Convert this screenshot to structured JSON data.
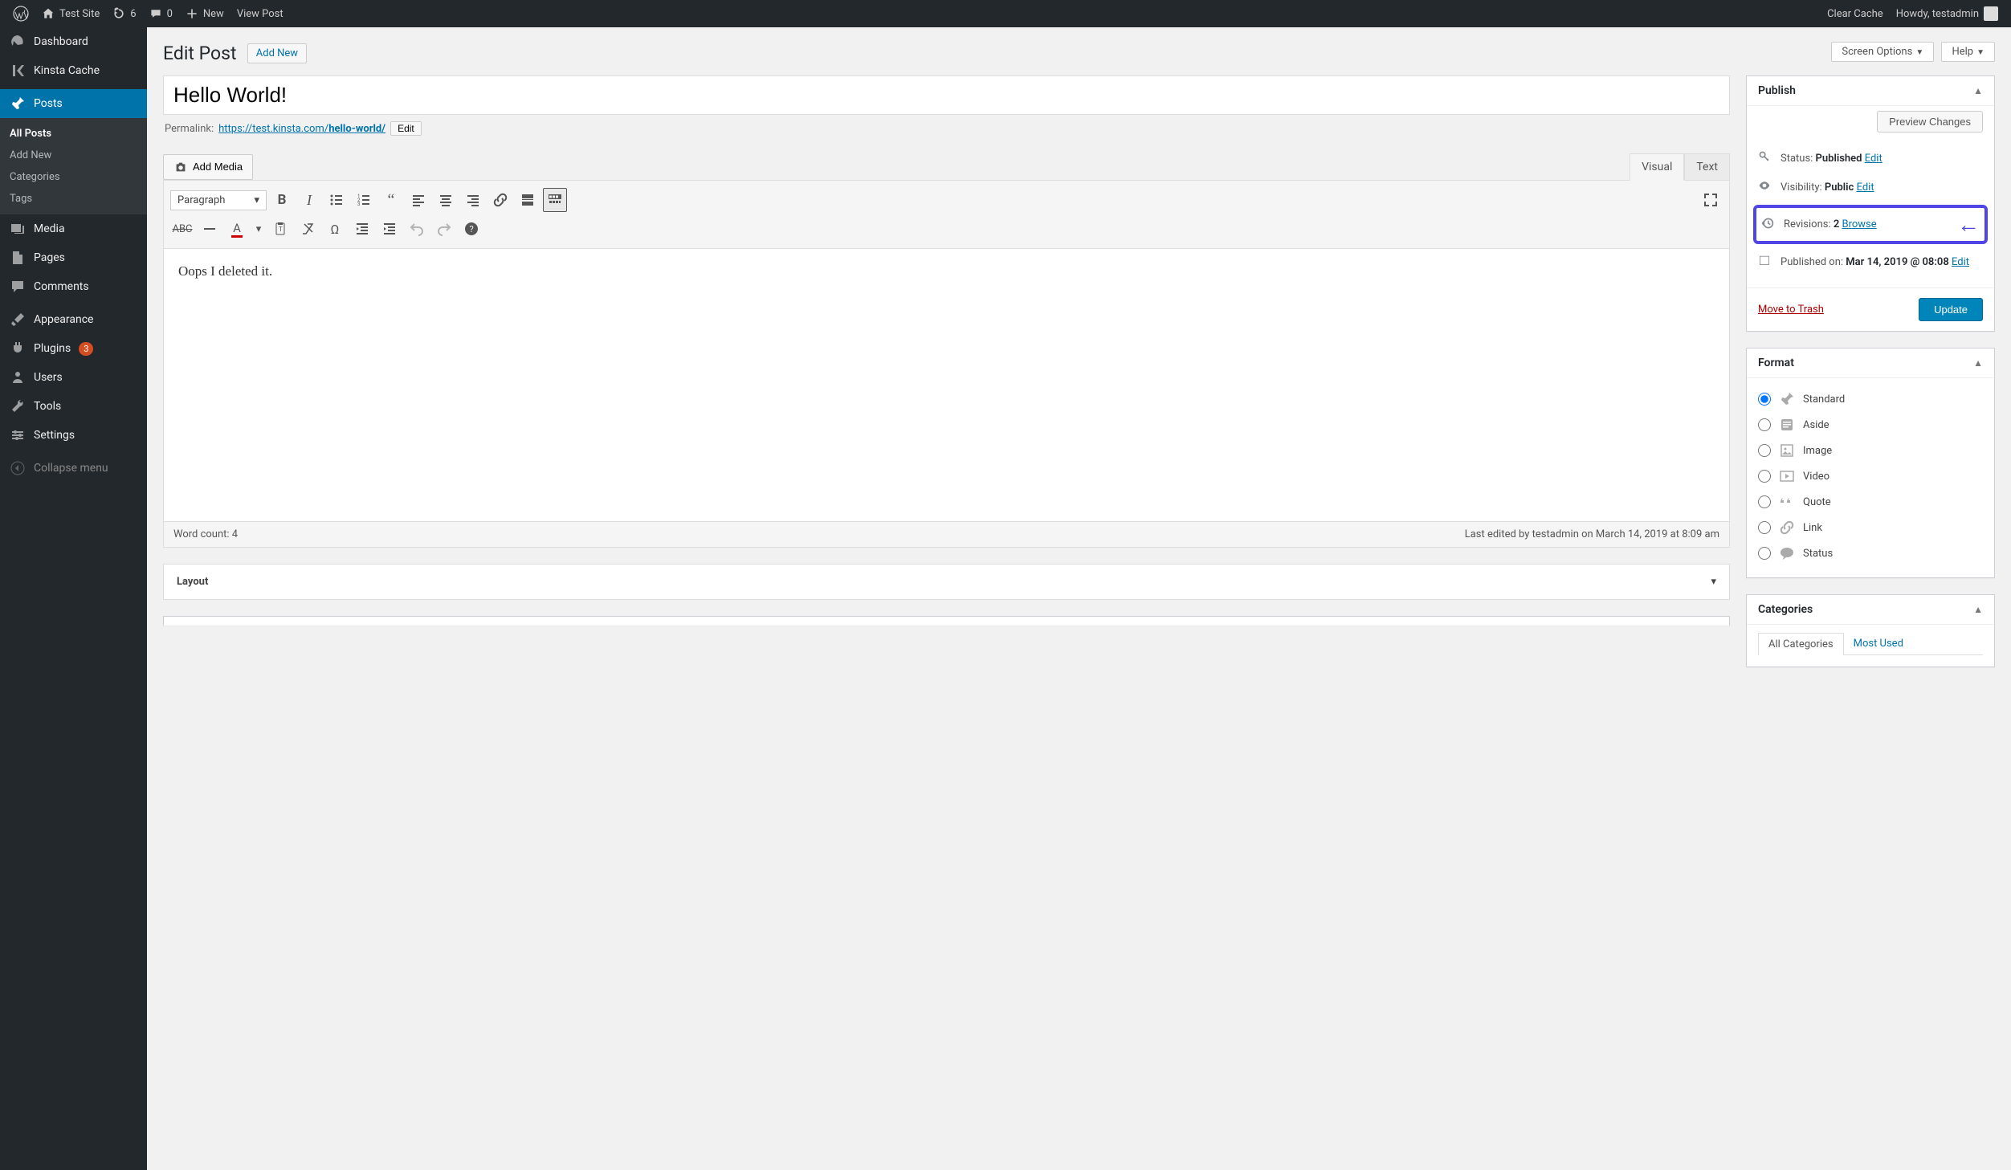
{
  "adminbar": {
    "site_name": "Test Site",
    "updates_count": "6",
    "comments_count": "0",
    "new_label": "New",
    "view_post": "View Post",
    "clear_cache": "Clear Cache",
    "howdy": "Howdy, testadmin"
  },
  "sidebar": {
    "dashboard": "Dashboard",
    "kinsta": "Kinsta Cache",
    "posts": "Posts",
    "all_posts": "All Posts",
    "add_new": "Add New",
    "categories": "Categories",
    "tags": "Tags",
    "media": "Media",
    "pages": "Pages",
    "comments": "Comments",
    "appearance": "Appearance",
    "plugins": "Plugins",
    "plugins_count": "3",
    "users": "Users",
    "tools": "Tools",
    "settings": "Settings",
    "collapse": "Collapse menu"
  },
  "topbuttons": {
    "screen_options": "Screen Options",
    "help": "Help"
  },
  "page": {
    "heading": "Edit Post",
    "add_new": "Add New",
    "title_value": "Hello World!",
    "permalink_label": "Permalink:",
    "permalink_base": "https://test.kinsta.com/",
    "permalink_slug": "hello-world/",
    "permalink_edit": "Edit",
    "add_media": "Add Media",
    "tab_visual": "Visual",
    "tab_text": "Text",
    "format_dropdown": "Paragraph",
    "content": "Oops I deleted it.",
    "word_count_label": "Word count: ",
    "word_count": "4",
    "last_edited": "Last edited by testadmin on March 14, 2019 at 8:09 am",
    "layout_title": "Layout"
  },
  "publish": {
    "title": "Publish",
    "preview": "Preview Changes",
    "status_label": "Status: ",
    "status_value": "Published",
    "visibility_label": "Visibility: ",
    "visibility_value": "Public",
    "revisions_label": "Revisions: ",
    "revisions_count": "2",
    "browse": "Browse",
    "published_label": "Published on: ",
    "published_value": "Mar 14, 2019 @ 08:08",
    "edit": "Edit",
    "trash": "Move to Trash",
    "update": "Update"
  },
  "format": {
    "title": "Format",
    "options": [
      "Standard",
      "Aside",
      "Image",
      "Video",
      "Quote",
      "Link",
      "Status"
    ],
    "selected": "Standard"
  },
  "categories": {
    "title": "Categories",
    "tab_all": "All Categories",
    "tab_most": "Most Used"
  }
}
